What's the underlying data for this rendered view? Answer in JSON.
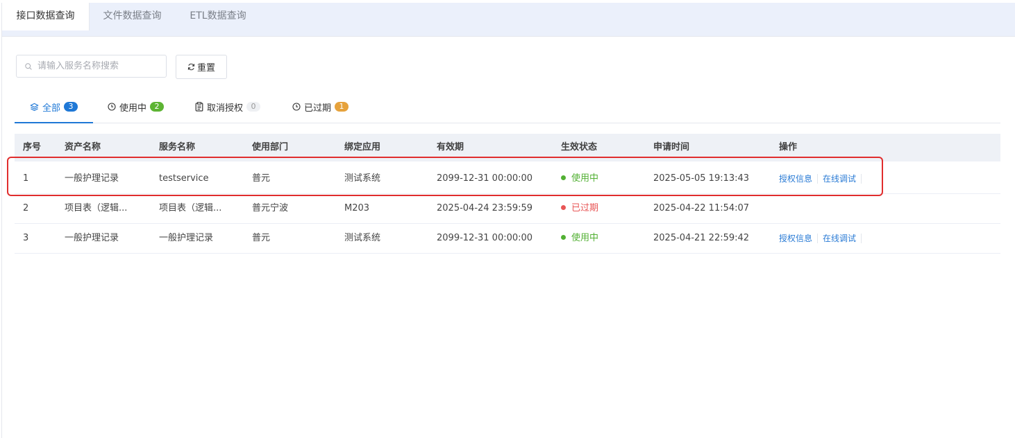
{
  "top_tabs": [
    "接口数据查询",
    "文件数据查询",
    "ETL数据查询"
  ],
  "search": {
    "placeholder": "请输入服务名称搜索",
    "value": ""
  },
  "reset_label": "重置",
  "status_tabs": [
    {
      "label": "全部",
      "count": "3",
      "icon": "layers-icon",
      "badge_color": "#1f78d6"
    },
    {
      "label": "使用中",
      "count": "2",
      "icon": "clock-icon",
      "badge_color": "#5db433"
    },
    {
      "label": "取消授权",
      "count": "0",
      "icon": "clipboard-icon",
      "badge_color": "#eef0f3"
    },
    {
      "label": "已过期",
      "count": "1",
      "icon": "clock-icon",
      "badge_color": "#e6a23c"
    }
  ],
  "table": {
    "columns": [
      "序号",
      "资产名称",
      "服务名称",
      "使用部门",
      "绑定应用",
      "有效期",
      "生效状态",
      "申请时间",
      "操作"
    ],
    "rows": [
      {
        "no": "1",
        "asset": "一般护理记录",
        "service": "testservice",
        "dept": "普元",
        "app": "测试系统",
        "valid": "2099-12-31 00:00:00",
        "status": "使用中",
        "applied": "2025-05-05 19:13:43",
        "ops": [
          "授权信息",
          "在线调试"
        ]
      },
      {
        "no": "2",
        "asset": "项目表（逻辑...",
        "service": "项目表（逻辑...",
        "dept": "普元宁波",
        "app": "M203",
        "valid": "2025-04-24 23:59:59",
        "status": "已过期",
        "applied": "2025-04-22 11:54:07",
        "ops": []
      },
      {
        "no": "3",
        "asset": "一般护理记录",
        "service": "一般护理记录",
        "dept": "普元",
        "app": "测试系统",
        "valid": "2099-12-31 00:00:00",
        "status": "使用中",
        "applied": "2025-04-21 22:59:42",
        "ops": [
          "授权信息",
          "在线调试"
        ]
      }
    ]
  },
  "colors": {
    "accent": "#1f78d6",
    "active_status": "#52b033",
    "expired_status": "#e85656",
    "highlight": "#e02d2d"
  }
}
